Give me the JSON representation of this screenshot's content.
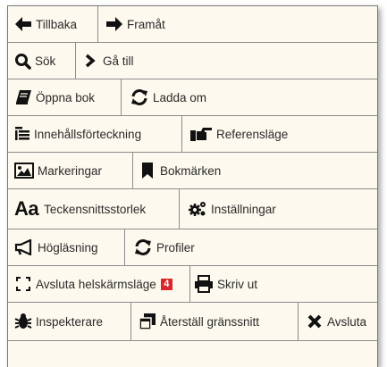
{
  "menu": {
    "back": {
      "label": "Tillbaka",
      "icon": "arrow-left-icon"
    },
    "forward": {
      "label": "Framåt",
      "icon": "arrow-right-icon"
    },
    "search": {
      "label": "Sök",
      "icon": "magnifier-icon"
    },
    "goto": {
      "label": "Gå till",
      "icon": "chevron-right-icon"
    },
    "open_book": {
      "label": "Öppna bok",
      "icon": "book-icon"
    },
    "reload": {
      "label": "Ladda om",
      "icon": "refresh-icon"
    },
    "toc": {
      "label": "Innehållsförteckning",
      "icon": "list-indent-icon"
    },
    "reference_mode": {
      "label": "Referensläge",
      "icon": "pointing-hand-icon"
    },
    "highlights": {
      "label": "Markeringar",
      "icon": "image-icon"
    },
    "bookmarks": {
      "label": "Bokmärken",
      "icon": "bookmark-icon"
    },
    "font_size": {
      "label": "Teckensnittsstorlek",
      "icon_text": "Aa"
    },
    "settings": {
      "label": "Inställningar",
      "icon": "gears-icon"
    },
    "read_aloud": {
      "label": "Högläsning",
      "icon": "megaphone-icon"
    },
    "profiles": {
      "label": "Profiler",
      "icon": "refresh-icon"
    },
    "exit_fullscreen": {
      "label": "Avsluta helskärmsläge",
      "icon": "compress-icon"
    },
    "print": {
      "label": "Skriv ut",
      "icon": "printer-icon",
      "badge": "4"
    },
    "inspector": {
      "label": "Inspekterare",
      "icon": "bug-icon"
    },
    "reset_ui": {
      "label": "Återställ gränssnitt",
      "icon": "window-restore-icon"
    },
    "quit": {
      "label": "Avsluta",
      "icon": "close-icon"
    }
  },
  "colors": {
    "background": "#fdf9ee",
    "border": "#8d8d8d",
    "badge": "#d9262b",
    "icon": "#111111"
  }
}
